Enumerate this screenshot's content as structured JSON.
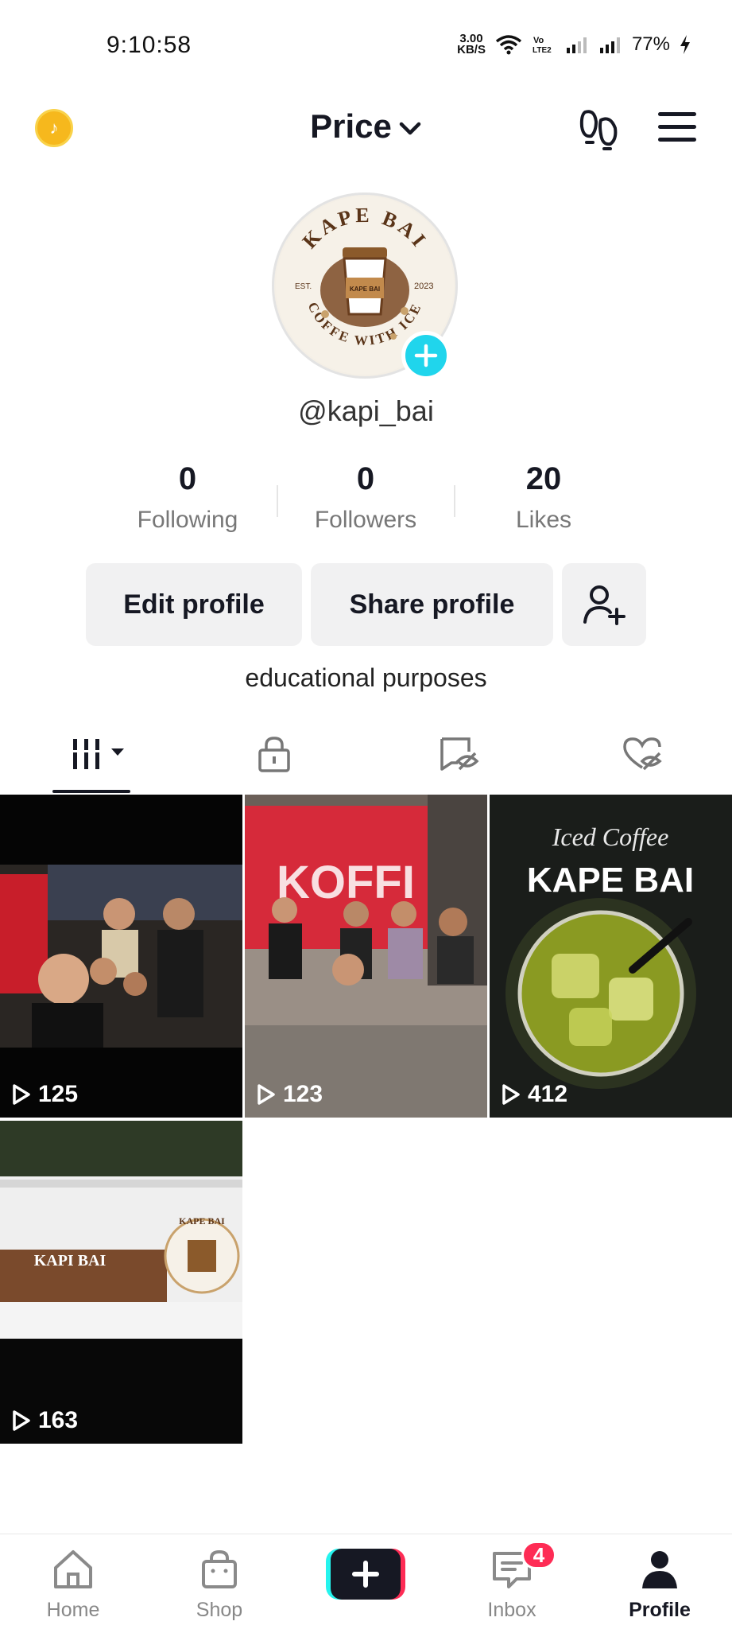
{
  "status_bar": {
    "time": "9:10:58",
    "speed_value": "3.00",
    "speed_unit": "KB/S",
    "battery": "77%"
  },
  "header": {
    "title": "Price",
    "icons": [
      "tiktok-coin-icon",
      "chevron-down-icon",
      "footprint-icon",
      "menu-icon"
    ]
  },
  "profile": {
    "username": "@kapi_bai",
    "bio": "educational purposes",
    "avatar_texts": {
      "brand": "KAPE BAI",
      "est": "EST.",
      "year": "2023",
      "tagline": "COFFE WITH ICE",
      "cup_label": "KAPE BAI"
    }
  },
  "stats": [
    {
      "value": "0",
      "label": "Following"
    },
    {
      "value": "0",
      "label": "Followers"
    },
    {
      "value": "20",
      "label": "Likes"
    }
  ],
  "buttons": {
    "edit": "Edit profile",
    "share": "Share profile"
  },
  "tabs": [
    "videos-grid-icon",
    "lock-icon",
    "repost-icon",
    "liked-hidden-icon"
  ],
  "videos": [
    {
      "views": "125"
    },
    {
      "views": "123",
      "sign_text": "KOFFI"
    },
    {
      "views": "412",
      "heading": "Iced Coffee",
      "title": "KAPE BAI"
    },
    {
      "views": "163",
      "heading": "KAPI BAI",
      "logo_text": "KAPE BAI"
    }
  ],
  "bottom_nav": {
    "home": "Home",
    "shop": "Shop",
    "inbox": "Inbox",
    "inbox_badge": "4",
    "profile": "Profile"
  },
  "colors": {
    "accent_cyan": "#20d5ec",
    "accent_red": "#fe2c55",
    "coin": "#f6b81d"
  }
}
